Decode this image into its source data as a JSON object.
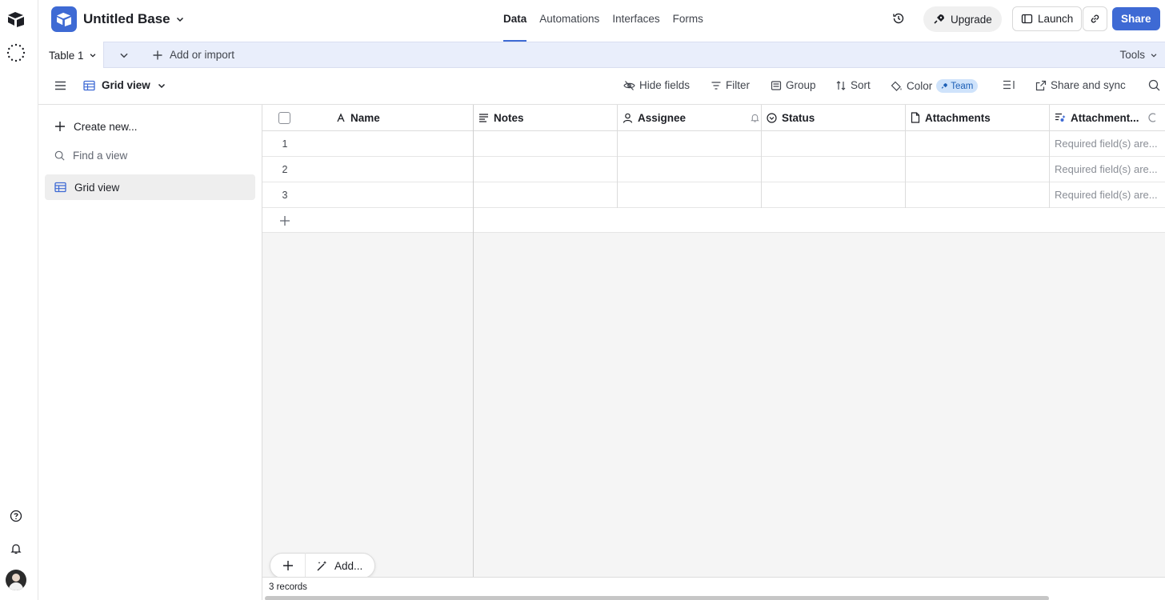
{
  "base": {
    "title": "Untitled Base"
  },
  "nav": {
    "tabs": [
      "Data",
      "Automations",
      "Interfaces",
      "Forms"
    ],
    "active": "Data"
  },
  "actions": {
    "upgrade": "Upgrade",
    "launch": "Launch",
    "share": "Share"
  },
  "tablebar": {
    "table_name": "Table 1",
    "add_or_import": "Add or import",
    "tools": "Tools"
  },
  "view": {
    "name": "Grid view",
    "hide_fields": "Hide fields",
    "filter": "Filter",
    "group": "Group",
    "sort": "Sort",
    "color": "Color",
    "team_badge": "Team",
    "share_and_sync": "Share and sync"
  },
  "sidebar": {
    "create_new": "Create new...",
    "find_placeholder": "Find a view",
    "views": [
      "Grid view"
    ]
  },
  "columns": [
    {
      "name": "Name",
      "icon": "text-icon"
    },
    {
      "name": "Notes",
      "icon": "long-text-icon"
    },
    {
      "name": "Assignee",
      "icon": "user-icon"
    },
    {
      "name": "Status",
      "icon": "status-icon"
    },
    {
      "name": "Attachments",
      "icon": "document-icon"
    },
    {
      "name": "Attachment...",
      "icon": "ai-field-icon"
    }
  ],
  "rows": [
    {
      "num": "1",
      "attachment_summary": "Required field(s) are..."
    },
    {
      "num": "2",
      "attachment_summary": "Required field(s) are..."
    },
    {
      "num": "3",
      "attachment_summary": "Required field(s) are..."
    }
  ],
  "footer": {
    "add_label": "Add...",
    "records": "3 records"
  },
  "colors": {
    "accent": "#3e6ad4",
    "tablebar_bg": "#e9eefb",
    "team_badge_bg": "#cfe3fb"
  }
}
